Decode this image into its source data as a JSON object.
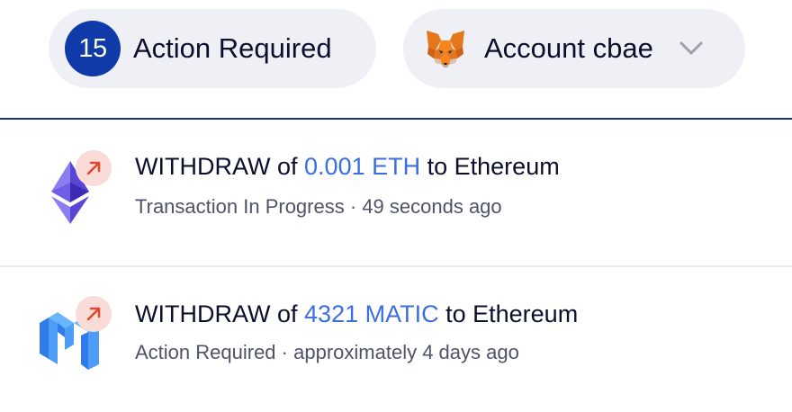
{
  "header": {
    "action_required": {
      "count": "15",
      "label": "Action Required"
    },
    "account": {
      "icon": "metamask-fox-icon",
      "label": "Account cbae",
      "dropdown_icon": "chevron-down-icon"
    }
  },
  "transactions": [
    {
      "token_icon": "ethereum-icon",
      "direction_icon": "arrow-up-right-icon",
      "action": "WITHDRAW",
      "of_text": "of",
      "amount": "0.001 ETH",
      "to_text": "to Ethereum",
      "status": "Transaction In Progress",
      "separator": "·",
      "time": "49 seconds ago"
    },
    {
      "token_icon": "polygon-matic-icon",
      "direction_icon": "arrow-up-right-icon",
      "action": "WITHDRAW",
      "of_text": "of",
      "amount": "4321 MATIC",
      "to_text": "to Ethereum",
      "status": "Action Required",
      "separator": "·",
      "time": "approximately 4 days ago"
    }
  ],
  "colors": {
    "badge_blue": "#0f3aa8",
    "pill_bg": "#eef0f5",
    "amount_blue": "#3c6ee0",
    "arrow_red": "#e0492f",
    "arrow_badge_bg": "#f9dcd7",
    "header_divider": "#1a3573",
    "row_divider": "#ececf1",
    "text_primary": "#0b0f2b",
    "text_secondary": "#4d5469"
  }
}
